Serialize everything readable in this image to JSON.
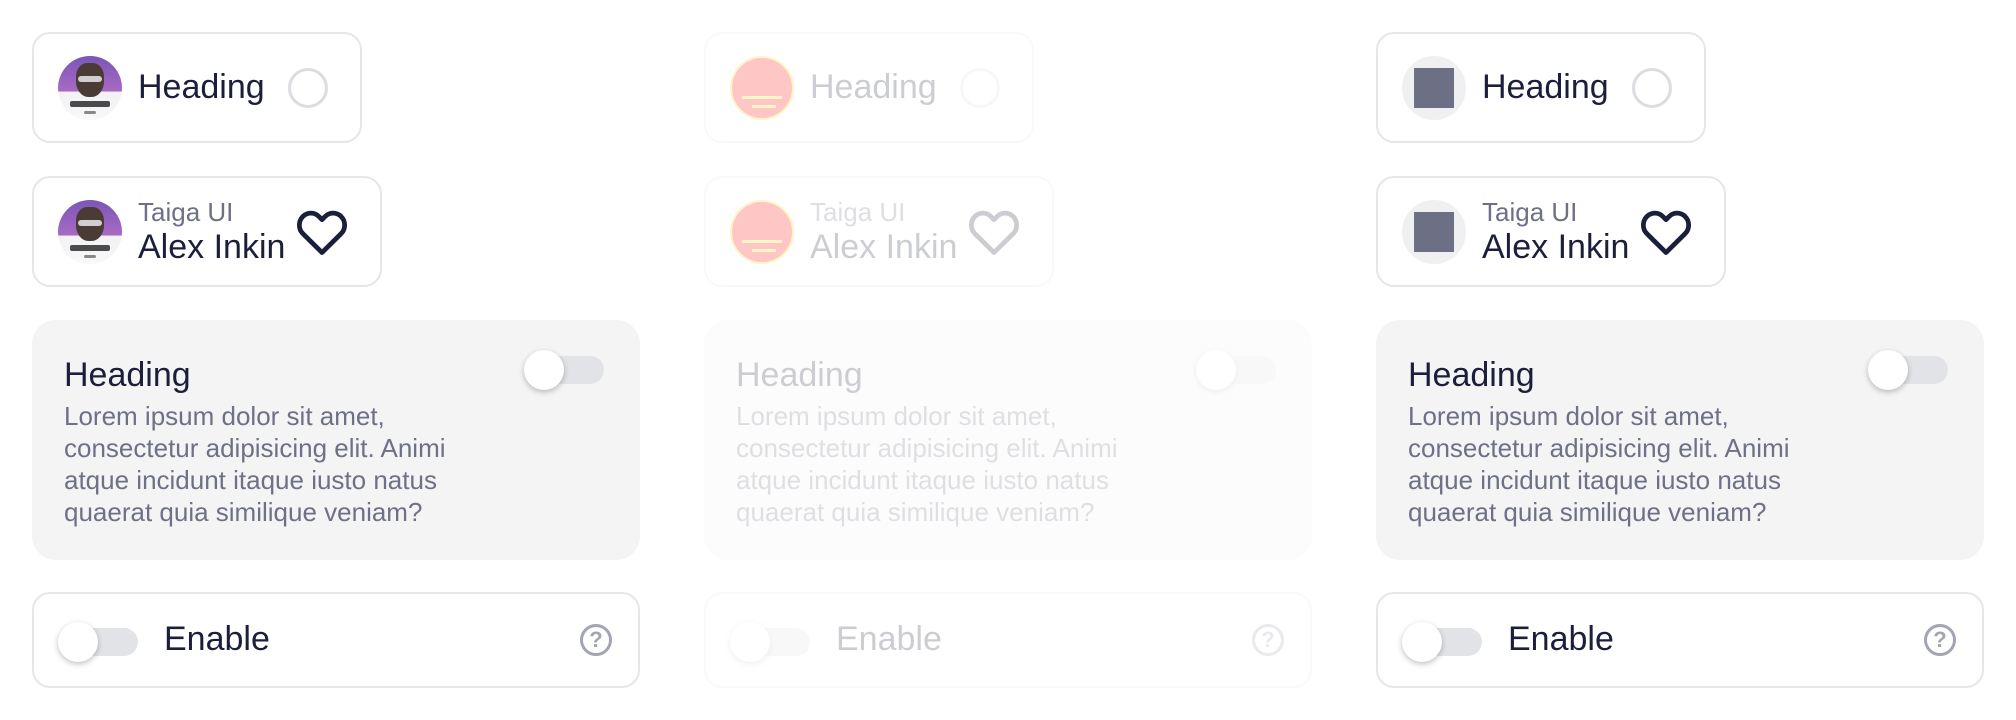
{
  "columns": [
    {
      "state": "enabled",
      "avatar_type": "photo",
      "small_card": {
        "heading": "Heading"
      },
      "medium_card": {
        "subtitle": "Taiga UI",
        "name": "Alex Inkin"
      },
      "large_card": {
        "heading": "Heading",
        "text": "Lorem ipsum dolor sit amet, consectetur adipisicing elit. Animi atque incidunt itaque iusto natus quaerat quia similique veniam?"
      },
      "enable_card": {
        "label": "Enable"
      }
    },
    {
      "state": "disabled",
      "avatar_type": "red",
      "small_card": {
        "heading": "Heading"
      },
      "medium_card": {
        "subtitle": "Taiga UI",
        "name": "Alex Inkin"
      },
      "large_card": {
        "heading": "Heading",
        "text": "Lorem ipsum dolor sit amet, consectetur adipisicing elit. Animi atque incidunt itaque iusto natus quaerat quia similique veniam?"
      },
      "enable_card": {
        "label": "Enable"
      }
    },
    {
      "state": "enabled",
      "avatar_type": "square",
      "small_card": {
        "heading": "Heading"
      },
      "medium_card": {
        "subtitle": "Taiga UI",
        "name": "Alex Inkin"
      },
      "large_card": {
        "heading": "Heading",
        "text": "Lorem ipsum dolor sit amet, consectetur adipisicing elit. Animi atque incidunt itaque iusto natus quaerat quia similique veniam?"
      },
      "enable_card": {
        "label": "Enable"
      }
    }
  ],
  "icons": {
    "radio": "radio-icon",
    "heart": "heart-icon",
    "help": "help-circle-icon",
    "help_glyph": "?"
  },
  "colors": {
    "text_primary": "#1b1f3b",
    "text_secondary": "#6e7185",
    "card_border": "#e5e6ea",
    "large_card_bg": "#f4f4f5",
    "toggle_track": "#e2e3e6",
    "avatar_red": "#ff0000",
    "avatar_square": "#6d6f85"
  }
}
